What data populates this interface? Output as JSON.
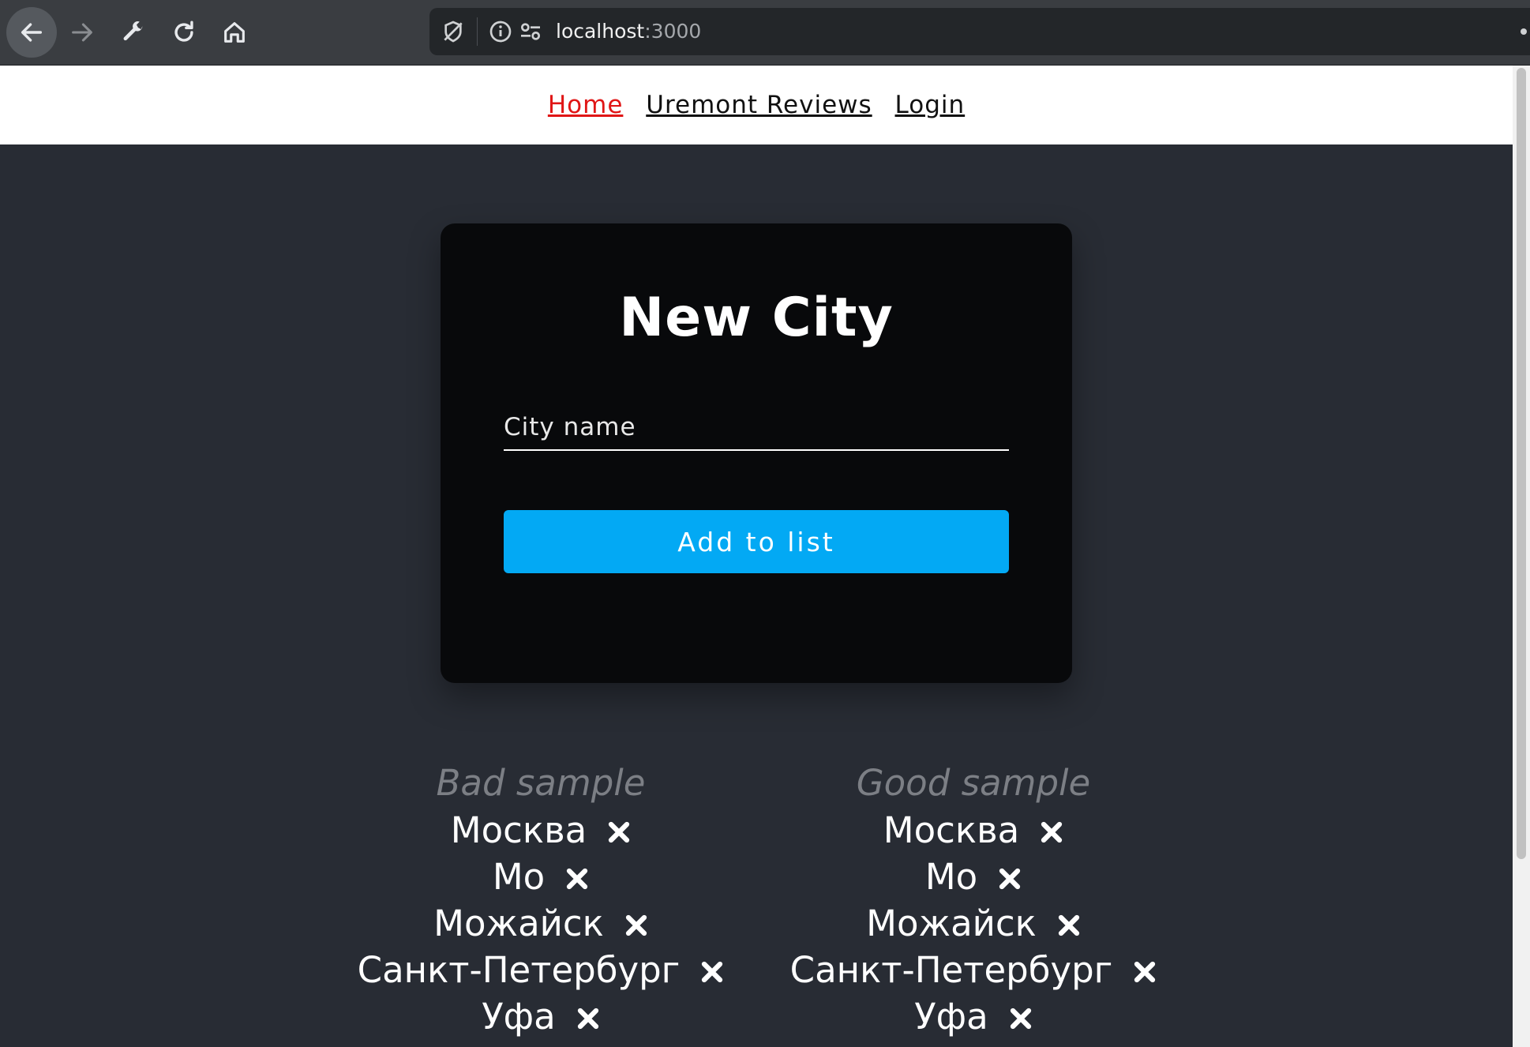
{
  "browser": {
    "url_host": "localhost",
    "url_port": ":3000",
    "icons": [
      "back-arrow-icon",
      "forward-arrow-icon",
      "wrench-icon",
      "reload-icon",
      "home-icon",
      "tracking-protection-icon",
      "info-icon",
      "site-settings-icon"
    ]
  },
  "nav": {
    "home": "Home",
    "reviews": "Uremont Reviews",
    "login": "Login",
    "active_color": "#e01616"
  },
  "card": {
    "title": "New City",
    "input_placeholder": "City name",
    "input_value": "",
    "button_label": "Add to list",
    "button_color": "#03a9f4"
  },
  "bad_sample": {
    "heading": "Bad sample",
    "items": [
      "Москва",
      "Мо",
      "Можайск",
      "Санкт-Петербург",
      "Уфа"
    ]
  },
  "good_sample": {
    "heading": "Good sample",
    "items": [
      "Москва",
      "Мо",
      "Можайск",
      "Санкт-Петербург",
      "Уфа"
    ]
  },
  "colors": {
    "page_bg": "#282c34",
    "card_bg": "#08090b"
  }
}
